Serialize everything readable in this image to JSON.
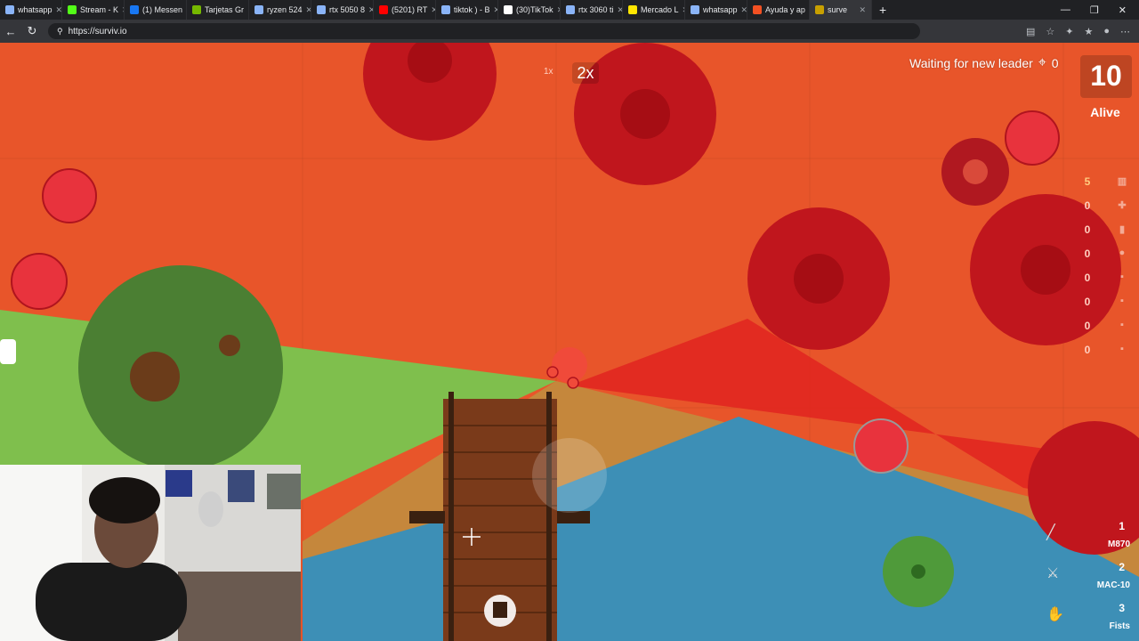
{
  "browser": {
    "tabs": [
      {
        "label": "whatsapp",
        "color": "#8ab4f8"
      },
      {
        "label": "Stream - K",
        "color": "#53fc18"
      },
      {
        "label": "(1) Messen",
        "color": "#1877f2"
      },
      {
        "label": "Tarjetas Gr",
        "color": "#76b900"
      },
      {
        "label": "ryzen 524",
        "color": "#8ab4f8"
      },
      {
        "label": "rtx 5050 8",
        "color": "#8ab4f8"
      },
      {
        "label": "(5201) RT",
        "color": "#ff0000"
      },
      {
        "label": "tiktok ) - B",
        "color": "#8ab4f8"
      },
      {
        "label": "(30)TikTok",
        "color": "#ffffff"
      },
      {
        "label": "rtx 3060 ti",
        "color": "#8ab4f8"
      },
      {
        "label": "Mercado L",
        "color": "#ffe600"
      },
      {
        "label": "whatsapp",
        "color": "#8ab4f8"
      },
      {
        "label": "Ayuda y ap",
        "color": "#f25022"
      },
      {
        "label": "surve",
        "color": "#c8a000"
      }
    ],
    "new_tab": "+",
    "url": "https://surviv.io"
  },
  "hud": {
    "zoom_small": "1x",
    "zoom_big": "2x",
    "leader_text": "Waiting for new leader",
    "kills": "0",
    "alive_count": "10",
    "alive_label": "Alive",
    "ammo": [
      {
        "count": "5",
        "icon": "bandage-icon",
        "color": "#ffcc80"
      },
      {
        "count": "0",
        "icon": "medkit-icon",
        "color": "#ffcfc0"
      },
      {
        "count": "0",
        "icon": "soda-icon",
        "color": "#ffcfc0"
      },
      {
        "count": "0",
        "icon": "pills-icon",
        "color": "#ffcfc0"
      },
      {
        "count": "0",
        "icon": "ammo-9mm-icon",
        "color": "#ffcfc0"
      },
      {
        "count": "0",
        "icon": "ammo-12g-icon",
        "color": "#ffcfc0"
      },
      {
        "count": "0",
        "icon": "ammo-556-icon",
        "color": "#ffcfc0"
      },
      {
        "count": "0",
        "icon": "ammo-762-icon",
        "color": "#ffcfc0"
      }
    ],
    "weapons": [
      {
        "slot": "1",
        "name": "M870"
      },
      {
        "slot": "2",
        "name": "MAC-10"
      },
      {
        "slot": "3",
        "name": "Fists"
      }
    ]
  },
  "colors": {
    "gas": "#e8552a",
    "grass": "#7fbf4d",
    "sand": "#c5873c",
    "water": "#3d8fb6",
    "bush_red": "#b8141c",
    "bridge": "#7a3a1a"
  }
}
